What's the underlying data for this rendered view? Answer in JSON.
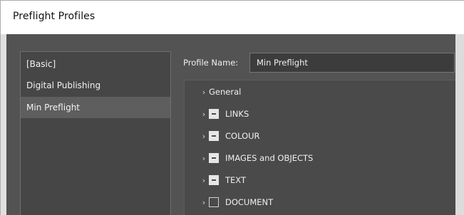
{
  "window": {
    "title": "Preflight Profiles"
  },
  "profiles": {
    "items": [
      {
        "label": "[Basic]",
        "selected": false
      },
      {
        "label": "Digital Publishing",
        "selected": false
      },
      {
        "label": "Min Preflight",
        "selected": true
      }
    ]
  },
  "profile_name": {
    "label": "Profile Name:",
    "value": "Min Preflight"
  },
  "tree": {
    "rows": [
      {
        "label": "General",
        "checkbox": "none",
        "icon": "chevron-right-icon"
      },
      {
        "label": "LINKS",
        "checkbox": "mixed",
        "icon": "chevron-right-icon"
      },
      {
        "label": "COLOUR",
        "checkbox": "mixed",
        "icon": "chevron-right-icon"
      },
      {
        "label": "IMAGES and OBJECTS",
        "checkbox": "mixed",
        "icon": "chevron-right-icon"
      },
      {
        "label": "TEXT",
        "checkbox": "mixed",
        "icon": "chevron-right-icon"
      },
      {
        "label": "DOCUMENT",
        "checkbox": "unchecked",
        "icon": "chevron-right-icon"
      }
    ]
  },
  "colors": {
    "panel": "#535353",
    "list_bg": "#464646",
    "selected_row": "#5e5e5e",
    "text": "#f0f0f0"
  }
}
